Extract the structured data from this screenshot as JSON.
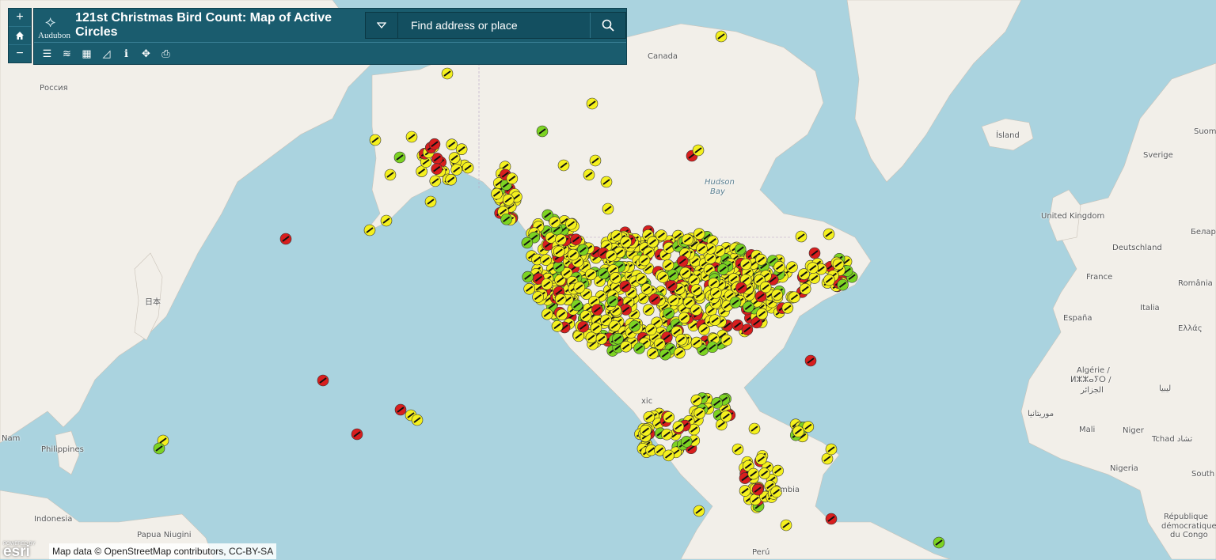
{
  "app": {
    "title": "121st Christmas Bird Count: Map of Active Circles",
    "logo_text": "Audubon",
    "logo_icon": "bird-logo"
  },
  "search": {
    "placeholder": "Find address or place"
  },
  "zoom": {
    "in_label": "+",
    "home_icon": "home-icon",
    "out_label": "−"
  },
  "toolbar": [
    {
      "name": "legend-icon",
      "glyph": "☰"
    },
    {
      "name": "layers-icon",
      "glyph": "≋"
    },
    {
      "name": "basemap-gallery-icon",
      "glyph": "▦"
    },
    {
      "name": "measure-icon",
      "glyph": "◿"
    },
    {
      "name": "info-icon",
      "glyph": "ℹ"
    },
    {
      "name": "locate-icon",
      "glyph": "✥"
    },
    {
      "name": "print-icon",
      "glyph": "⎙"
    }
  ],
  "map_labels": [
    {
      "text": "Россия",
      "pos": "r1"
    },
    {
      "text": "Canada",
      "pos": "r2"
    },
    {
      "text": "Hudson",
      "pos": "r3"
    },
    {
      "text": "Bay",
      "pos": "r4"
    },
    {
      "text": "Ísland",
      "pos": "r5"
    },
    {
      "text": "Sverige",
      "pos": "r6"
    },
    {
      "text": "Suom",
      "pos": "r7"
    },
    {
      "text": "United Kingdom",
      "pos": "r8"
    },
    {
      "text": "Deutschland",
      "pos": "r9"
    },
    {
      "text": "Белар",
      "pos": "r10"
    },
    {
      "text": "France",
      "pos": "r11"
    },
    {
      "text": "România",
      "pos": "r12"
    },
    {
      "text": "Italia",
      "pos": "r13"
    },
    {
      "text": "España",
      "pos": "r14"
    },
    {
      "text": "Ελλάς",
      "pos": "r15"
    },
    {
      "text": "Algérie /",
      "pos": "r16"
    },
    {
      "text": "ⵍⵣⵣⴰⵢⵔ /",
      "pos": "r17"
    },
    {
      "text": "الجزائر",
      "pos": "r18"
    },
    {
      "text": "ليبيا",
      "pos": "r19"
    },
    {
      "text": "موريتانيا",
      "pos": "r20"
    },
    {
      "text": "Mali",
      "pos": "r21"
    },
    {
      "text": "Niger",
      "pos": "r22"
    },
    {
      "text": "Tchad تشاد",
      "pos": "r23"
    },
    {
      "text": "Nigeria",
      "pos": "r24"
    },
    {
      "text": "South",
      "pos": "r25"
    },
    {
      "text": "République",
      "pos": "r26"
    },
    {
      "text": "démocratique",
      "pos": "r27"
    },
    {
      "text": "du Congo",
      "pos": "r28"
    },
    {
      "text": "日本",
      "pos": "r29"
    },
    {
      "text": "Philippines",
      "pos": "r30"
    },
    {
      "text": "Nam",
      "pos": "r31"
    },
    {
      "text": "Indonesia",
      "pos": "r32"
    },
    {
      "text": "Papua Niugini",
      "pos": "r33"
    },
    {
      "text": "Perú",
      "pos": "r34"
    },
    {
      "text": "xic",
      "pos": "r35"
    },
    {
      "text": "mbia",
      "pos": "r36"
    }
  ],
  "legend_colors": {
    "green": "#7cd322",
    "yellow": "#f4f01e",
    "red": "#d81e1e"
  },
  "attribution": {
    "powered_by": "POWERED BY",
    "esri": "esri",
    "credits": "Map data © OpenStreetMap contributors, CC-BY-SA"
  }
}
